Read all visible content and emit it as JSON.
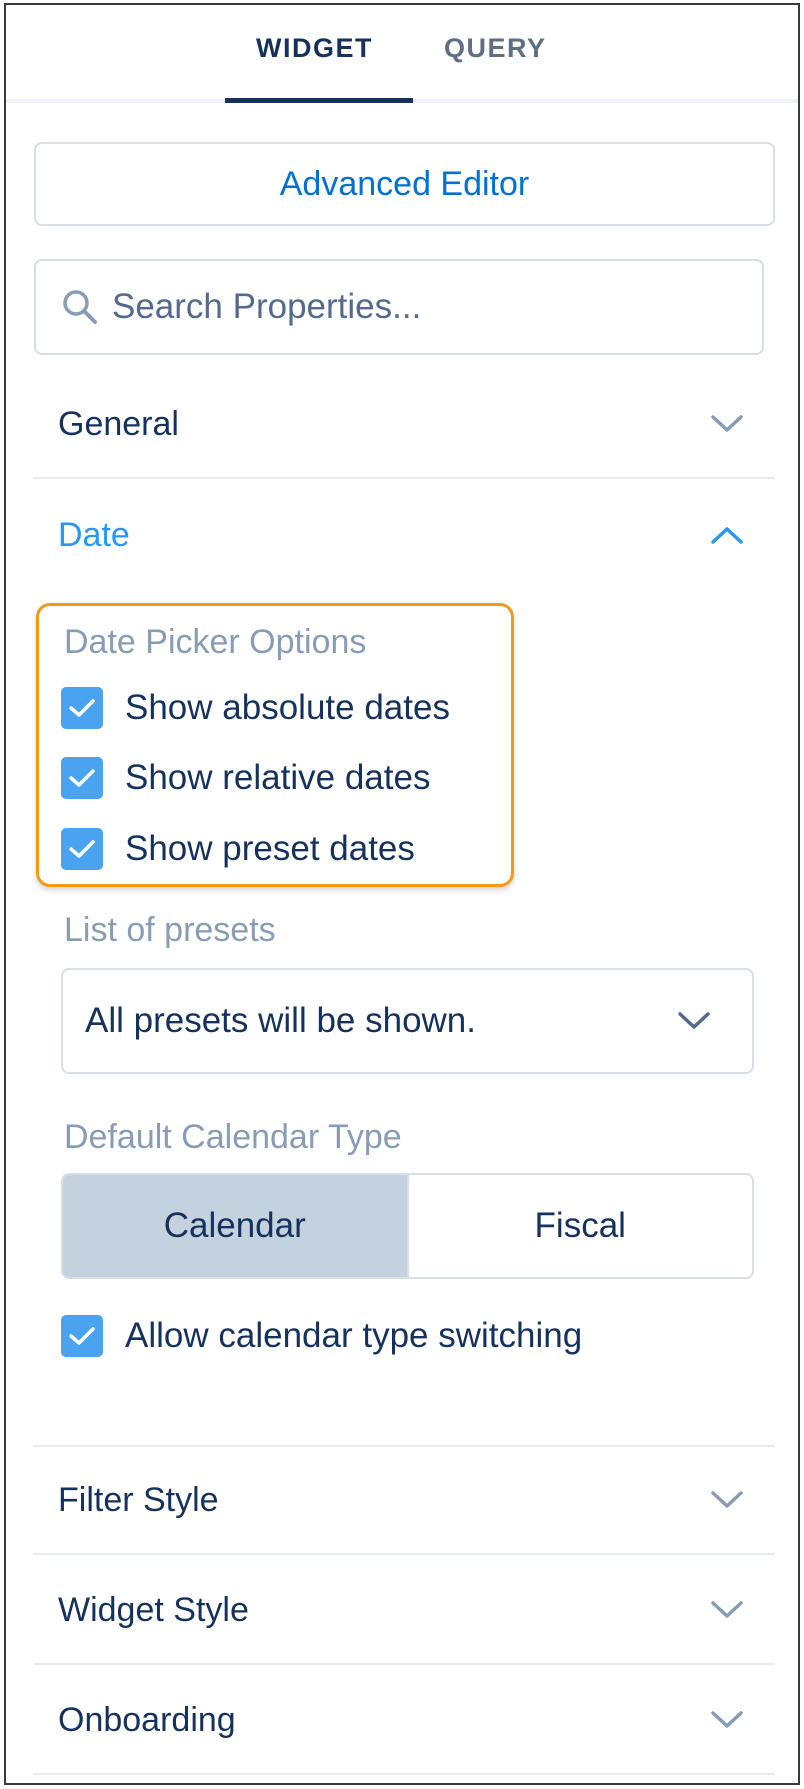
{
  "tabs": [
    {
      "label": "WIDGET",
      "active": true
    },
    {
      "label": "QUERY",
      "active": false
    }
  ],
  "advanced_editor_label": "Advanced Editor",
  "search": {
    "placeholder": "Search Properties...",
    "value": ""
  },
  "sections": {
    "general": "General",
    "date": "Date",
    "filter_style": "Filter Style",
    "widget_style": "Widget Style",
    "onboarding": "Onboarding"
  },
  "date_picker": {
    "label": "Date Picker Options",
    "options": [
      {
        "label": "Show absolute dates",
        "checked": true
      },
      {
        "label": "Show relative dates",
        "checked": true
      },
      {
        "label": "Show preset dates",
        "checked": true
      }
    ]
  },
  "presets": {
    "label": "List of presets",
    "selected": "All presets will be shown."
  },
  "calendar_type": {
    "label": "Default Calendar Type",
    "options": [
      "Calendar",
      "Fiscal"
    ],
    "selected": "Calendar"
  },
  "allow_switching": {
    "label": "Allow calendar type switching",
    "checked": true
  },
  "colors": {
    "accent": "#2997f3",
    "checkbox": "#4aa3f0",
    "highlight_border": "#ef9a1a",
    "text_primary": "#16325c",
    "text_muted": "#8a9bb6"
  },
  "icons": {
    "search": "search-icon",
    "expand": "chevron-down-icon",
    "collapse": "chevron-up-icon",
    "check": "checkmark-icon"
  }
}
